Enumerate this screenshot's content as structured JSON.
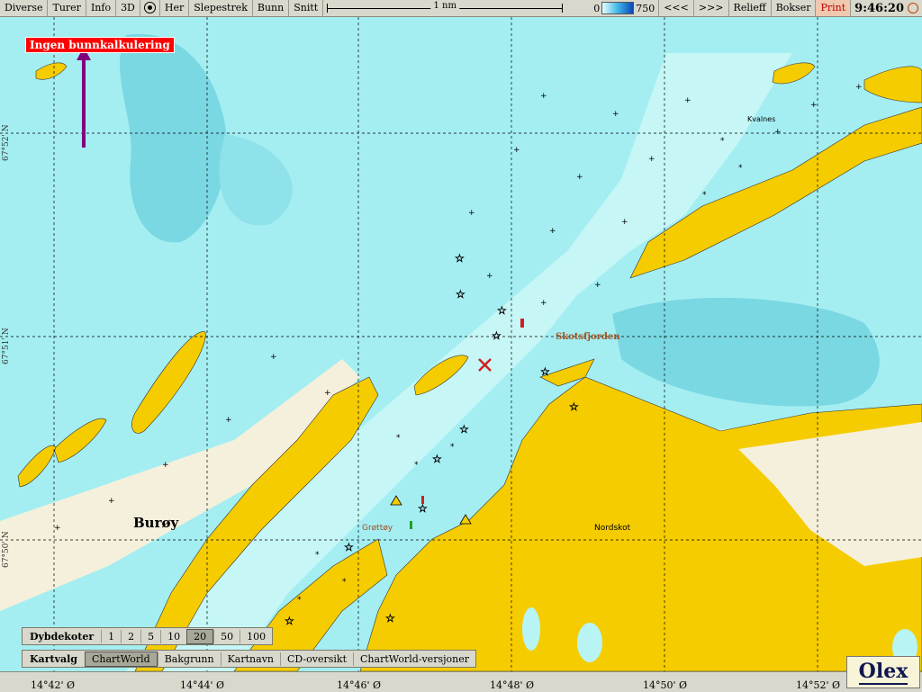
{
  "toolbar": {
    "items": [
      "Diverse",
      "Turer",
      "Info",
      "3D",
      "Her",
      "Slepestrek",
      "Bunn",
      "Snitt"
    ],
    "scale_label": "1 nm",
    "depth_min": "0",
    "depth_max": "750",
    "nav_back": "<<<",
    "nav_forward": ">>>",
    "relief": "Relieff",
    "bokser": "Bokser",
    "print": "Print",
    "clock": "9:46:20"
  },
  "map": {
    "alert": "Ingen bunnkalkulering",
    "places": {
      "buroy": "Burøy",
      "skotsfjorden": "Skotsfjorden",
      "kvalnes": "Kvalnes",
      "nordskot": "Nordskot",
      "grotoy": "Grøttøy"
    },
    "latitudes": [
      "67°52' N",
      "67°51' N",
      "67°50' N"
    ],
    "longitudes": [
      "14°42' Ø",
      "14°44' Ø",
      "14°46' Ø",
      "14°48' Ø",
      "14°50' Ø",
      "14°52' Ø"
    ]
  },
  "depth_contours": {
    "title": "Dybdekoter",
    "options": [
      "1",
      "2",
      "5",
      "10",
      "20",
      "50",
      "100"
    ],
    "selected": "20"
  },
  "chart_select": {
    "title": "Kartvalg",
    "options": [
      "ChartWorld",
      "Bakgrunn",
      "Kartnavn",
      "CD-oversikt",
      "ChartWorld-versjoner"
    ],
    "selected": "ChartWorld"
  },
  "logo": "Olex",
  "colors": {
    "land": "#f5cc00",
    "shallow": "#b8f4f4",
    "sea": "#99ecf0",
    "deep": "#66d0dc",
    "alert": "#ff0000",
    "arrow": "#800080"
  }
}
